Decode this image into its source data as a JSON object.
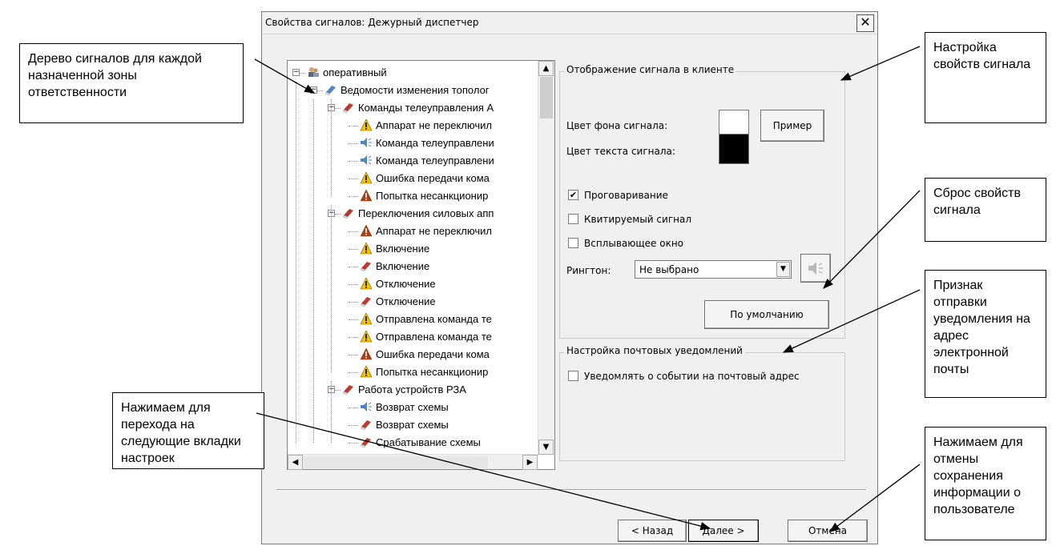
{
  "window": {
    "title": "Свойства сигналов: Дежурный диспетчер",
    "close_label": "✕"
  },
  "tree": {
    "items": [
      {
        "label": "оперативный",
        "icon": "user-group-icon",
        "color": "#5a6a7a"
      },
      {
        "label": "Ведомости изменения тополог",
        "icon": "eraser-icon",
        "color": "#4a86c8"
      },
      {
        "label": "Команды телеуправления А",
        "icon": "red-eraser-icon",
        "color": "#c0392b"
      },
      {
        "label": "Аппарат не переключил",
        "icon": "warning-yellow-icon",
        "color": "#f2c200"
      },
      {
        "label": "Команда телеуправлени",
        "icon": "speaker-icon",
        "color": "#4a86c8"
      },
      {
        "label": "Команда телеуправлени",
        "icon": "speaker-icon",
        "color": "#4a86c8"
      },
      {
        "label": "Ошибка передачи кома",
        "icon": "warning-yellow-icon",
        "color": "#f2c200"
      },
      {
        "label": "Попытка несанкционир",
        "icon": "warning-red-icon",
        "color": "#b03a1a"
      },
      {
        "label": "Переключения силовых апп",
        "icon": "red-eraser-icon",
        "color": "#c0392b"
      },
      {
        "label": "Аппарат не переключил",
        "icon": "warning-red-icon",
        "color": "#b03a1a"
      },
      {
        "label": "Включение",
        "icon": "warning-yellow-icon",
        "color": "#f2c200"
      },
      {
        "label": "Включение",
        "icon": "red-eraser-icon",
        "color": "#c0392b"
      },
      {
        "label": "Отключение",
        "icon": "warning-yellow-icon",
        "color": "#f2c200"
      },
      {
        "label": "Отключение",
        "icon": "red-eraser-icon",
        "color": "#c0392b"
      },
      {
        "label": "Отправлена команда те",
        "icon": "warning-yellow-icon",
        "color": "#f2c200"
      },
      {
        "label": "Отправлена команда те",
        "icon": "warning-yellow-icon",
        "color": "#f2c200"
      },
      {
        "label": "Ошибка передачи кома",
        "icon": "warning-red-icon",
        "color": "#b03a1a"
      },
      {
        "label": "Попытка несанкционир",
        "icon": "warning-yellow-icon",
        "color": "#f2c200"
      },
      {
        "label": "Работа устройств РЗА",
        "icon": "red-eraser-icon",
        "color": "#c0392b"
      },
      {
        "label": "Возврат схемы",
        "icon": "speaker-icon",
        "color": "#4a86c8"
      },
      {
        "label": "Возврат схемы",
        "icon": "red-eraser-icon",
        "color": "#c0392b"
      },
      {
        "label": "Срабатывание схемы",
        "icon": "red-eraser-icon",
        "color": "#c0392b"
      }
    ]
  },
  "display_group": {
    "legend": "Отображение сигнала в клиенте",
    "bg_color_label": "Цвет фона сигнала:",
    "bg_color_value": "#ffffff",
    "example_button": "Пример",
    "text_color_label": "Цвет текста сигнала:",
    "text_color_value": "#000000",
    "speak_label": "Проговаривание",
    "speak_checked": "✔",
    "ack_label": "Квитируемый сигнал",
    "popup_label": "Всплывающее окно",
    "ringtone_label": "Рингтон:",
    "ringtone_value": "Не выбрано",
    "default_button": "По умолчанию"
  },
  "mail_group": {
    "legend": "Настройка почтовых уведомлений",
    "notify_label": "Уведомлять о событии на почтовый адрес"
  },
  "footer": {
    "back_label": "< Назад",
    "next_label": "Далее >",
    "cancel_label": "Отмена"
  },
  "callouts": {
    "tree": "Дерево сигналов для каждой назначенной зоны ответственности",
    "props": "Настройка свойств сигнала",
    "reset": "Сброс свойств сигнала",
    "mail": "Признак отправки уведомления на адрес электронной почты",
    "next": "Нажимаем для перехода на следующие вкладки настроек",
    "cancel": "Нажимаем для отмены сохранения информации о пользователе"
  }
}
